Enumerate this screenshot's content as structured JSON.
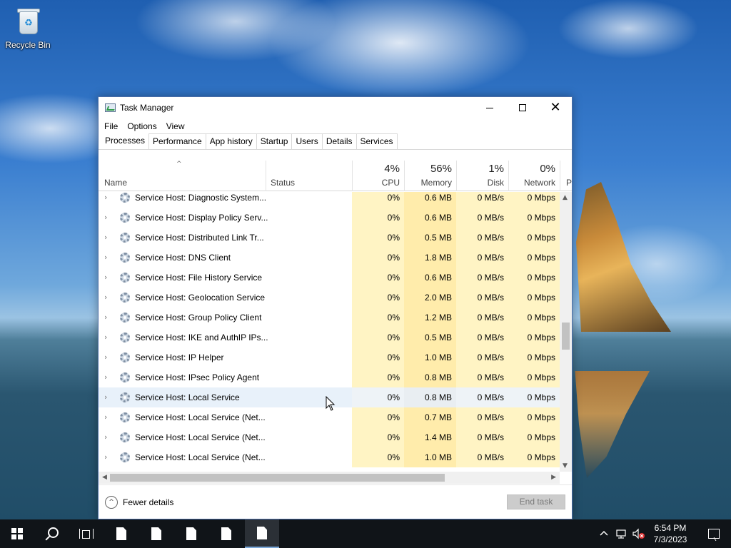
{
  "desktop": {
    "recycle_bin_label": "Recycle Bin"
  },
  "window": {
    "title": "Task Manager",
    "menu": [
      "File",
      "Options",
      "View"
    ],
    "tabs": [
      "Processes",
      "Performance",
      "App history",
      "Startup",
      "Users",
      "Details",
      "Services"
    ],
    "active_tab": "Processes"
  },
  "columns": {
    "name": "Name",
    "status": "Status",
    "cpu": {
      "pct": "4%",
      "label": "CPU"
    },
    "memory": {
      "pct": "56%",
      "label": "Memory"
    },
    "disk": {
      "pct": "1%",
      "label": "Disk"
    },
    "network": {
      "pct": "0%",
      "label": "Network"
    },
    "power": {
      "label": "P"
    }
  },
  "rows": [
    {
      "name": "Service Host: Diagnostic System...",
      "cpu": "0%",
      "memory": "0.6 MB",
      "disk": "0 MB/s",
      "network": "0 Mbps"
    },
    {
      "name": "Service Host: Display Policy Serv...",
      "cpu": "0%",
      "memory": "0.6 MB",
      "disk": "0 MB/s",
      "network": "0 Mbps"
    },
    {
      "name": "Service Host: Distributed Link Tr...",
      "cpu": "0%",
      "memory": "0.5 MB",
      "disk": "0 MB/s",
      "network": "0 Mbps"
    },
    {
      "name": "Service Host: DNS Client",
      "cpu": "0%",
      "memory": "1.8 MB",
      "disk": "0 MB/s",
      "network": "0 Mbps"
    },
    {
      "name": "Service Host: File History Service",
      "cpu": "0%",
      "memory": "0.6 MB",
      "disk": "0 MB/s",
      "network": "0 Mbps"
    },
    {
      "name": "Service Host: Geolocation Service",
      "cpu": "0%",
      "memory": "2.0 MB",
      "disk": "0 MB/s",
      "network": "0 Mbps"
    },
    {
      "name": "Service Host: Group Policy Client",
      "cpu": "0%",
      "memory": "1.2 MB",
      "disk": "0 MB/s",
      "network": "0 Mbps"
    },
    {
      "name": "Service Host: IKE and AuthIP IPs...",
      "cpu": "0%",
      "memory": "0.5 MB",
      "disk": "0 MB/s",
      "network": "0 Mbps"
    },
    {
      "name": "Service Host: IP Helper",
      "cpu": "0%",
      "memory": "1.0 MB",
      "disk": "0 MB/s",
      "network": "0 Mbps"
    },
    {
      "name": "Service Host: IPsec Policy Agent",
      "cpu": "0%",
      "memory": "0.8 MB",
      "disk": "0 MB/s",
      "network": "0 Mbps"
    },
    {
      "name": "Service Host: Local Service",
      "cpu": "0%",
      "memory": "0.8 MB",
      "disk": "0 MB/s",
      "network": "0 Mbps",
      "highlighted": true
    },
    {
      "name": "Service Host: Local Service (Net...",
      "cpu": "0%",
      "memory": "0.7 MB",
      "disk": "0 MB/s",
      "network": "0 Mbps"
    },
    {
      "name": "Service Host: Local Service (Net...",
      "cpu": "0%",
      "memory": "1.4 MB",
      "disk": "0 MB/s",
      "network": "0 Mbps"
    },
    {
      "name": "Service Host: Local Service (Net...",
      "cpu": "0%",
      "memory": "1.0 MB",
      "disk": "0 MB/s",
      "network": "0 Mbps"
    }
  ],
  "footer": {
    "fewer_details": "Fewer details",
    "end_task": "End task"
  },
  "taskbar": {
    "time": "6:54 PM",
    "date": "7/3/2023"
  },
  "colors": {
    "cpu_cell": "#fff4c4",
    "memory_cell": "#ffecab",
    "taskbar": "#101418"
  }
}
